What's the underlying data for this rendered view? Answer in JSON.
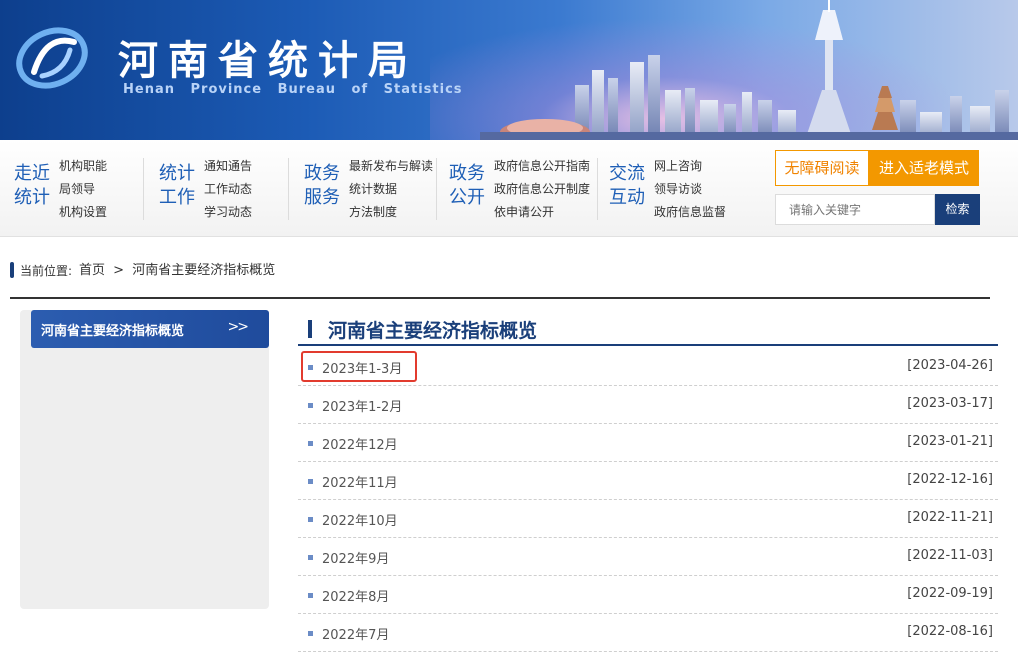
{
  "header": {
    "title": "河南省统计局",
    "subtitle": "Henan Province Bureau of Statistics"
  },
  "nav": [
    {
      "label_line1": "走近",
      "label_line2": "统计",
      "links": [
        "机构职能",
        "局领导",
        "机构设置"
      ]
    },
    {
      "label_line1": "统计",
      "label_line2": "工作",
      "links": [
        "通知通告",
        "工作动态",
        "学习动态"
      ]
    },
    {
      "label_line1": "政务",
      "label_line2": "服务",
      "links": [
        "最新发布与解读",
        "统计数据",
        "方法制度"
      ]
    },
    {
      "label_line1": "政务",
      "label_line2": "公开",
      "links": [
        "政府信息公开指南",
        "政府信息公开制度",
        "依申请公开"
      ]
    },
    {
      "label_line1": "交流",
      "label_line2": "互动",
      "links": [
        "网上咨询",
        "领导访谈",
        "政府信息监督"
      ]
    }
  ],
  "tools": {
    "accessible_label": "无障碍阅读",
    "elder_label": "进入适老模式",
    "search_placeholder": "请输入关键字",
    "search_button": "检索"
  },
  "breadcrumb": {
    "prefix": "当前位置:",
    "items": [
      "首页",
      ">",
      "河南省主要经济指标概览"
    ]
  },
  "sidebar": {
    "items": [
      {
        "label": "河南省主要经济指标概览",
        "arrow": ">>"
      }
    ]
  },
  "content": {
    "title": "河南省主要经济指标概览",
    "rows": [
      {
        "title": "2023年1-3月",
        "date": "[2023-04-26]"
      },
      {
        "title": "2023年1-2月",
        "date": "[2023-03-17]"
      },
      {
        "title": "2022年12月",
        "date": "[2023-01-21]"
      },
      {
        "title": "2022年11月",
        "date": "[2022-12-16]"
      },
      {
        "title": "2022年10月",
        "date": "[2022-11-21]"
      },
      {
        "title": "2022年9月",
        "date": "[2022-11-03]"
      },
      {
        "title": "2022年8月",
        "date": "[2022-09-19]"
      },
      {
        "title": "2022年7月",
        "date": "[2022-08-16]"
      }
    ]
  },
  "colors": {
    "primary": "#1a3f7a",
    "nav_text": "#1f5fb6",
    "accent_orange": "#f39800",
    "highlight_red": "#e23b2e"
  }
}
